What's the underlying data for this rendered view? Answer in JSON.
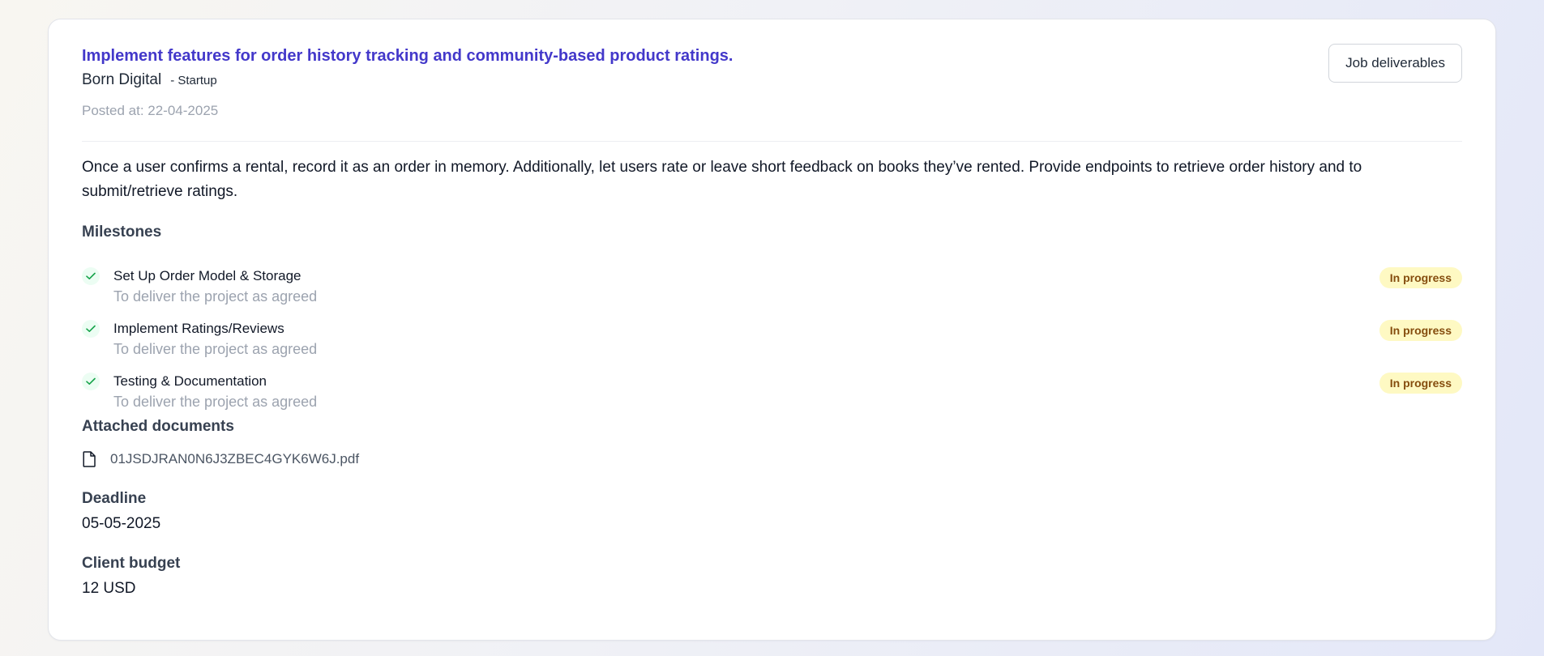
{
  "job": {
    "title": "Implement features for order history tracking and community-based product ratings.",
    "company": "Born Digital",
    "company_type": "- Startup",
    "posted_at": "Posted at: 22-04-2025",
    "deliverables_button": "Job deliverables",
    "description": "Once a user confirms a rental, record it as an order in memory. Additionally, let users rate or leave short feedback on books they’ve rented. Provide endpoints to retrieve order history and to submit/retrieve ratings."
  },
  "milestones": {
    "heading": "Milestones",
    "items": [
      {
        "title": "Set Up Order Model & Storage",
        "description": "To deliver the project as agreed",
        "status": "In progress",
        "icon": "check-icon"
      },
      {
        "title": "Implement Ratings/Reviews",
        "description": "To deliver the project as agreed",
        "status": "In progress",
        "icon": "check-icon"
      },
      {
        "title": "Testing & Documentation",
        "description": "To deliver the project as agreed",
        "status": "In progress",
        "icon": "check-icon"
      }
    ]
  },
  "attachments": {
    "heading": "Attached documents",
    "files": [
      {
        "name": "01JSDJRAN0N6J3ZBEC4GYK6W6J.pdf",
        "icon": "file-icon"
      }
    ]
  },
  "deadline": {
    "heading": "Deadline",
    "value": "05-05-2025"
  },
  "budget": {
    "heading": "Client budget",
    "value": "12 USD"
  },
  "colors": {
    "accent": "#4338ca",
    "status_badge_bg": "#fef9c3",
    "status_badge_text": "#854d0e",
    "check_bg": "#ecfdf3",
    "check_stroke": "#16a34a"
  }
}
